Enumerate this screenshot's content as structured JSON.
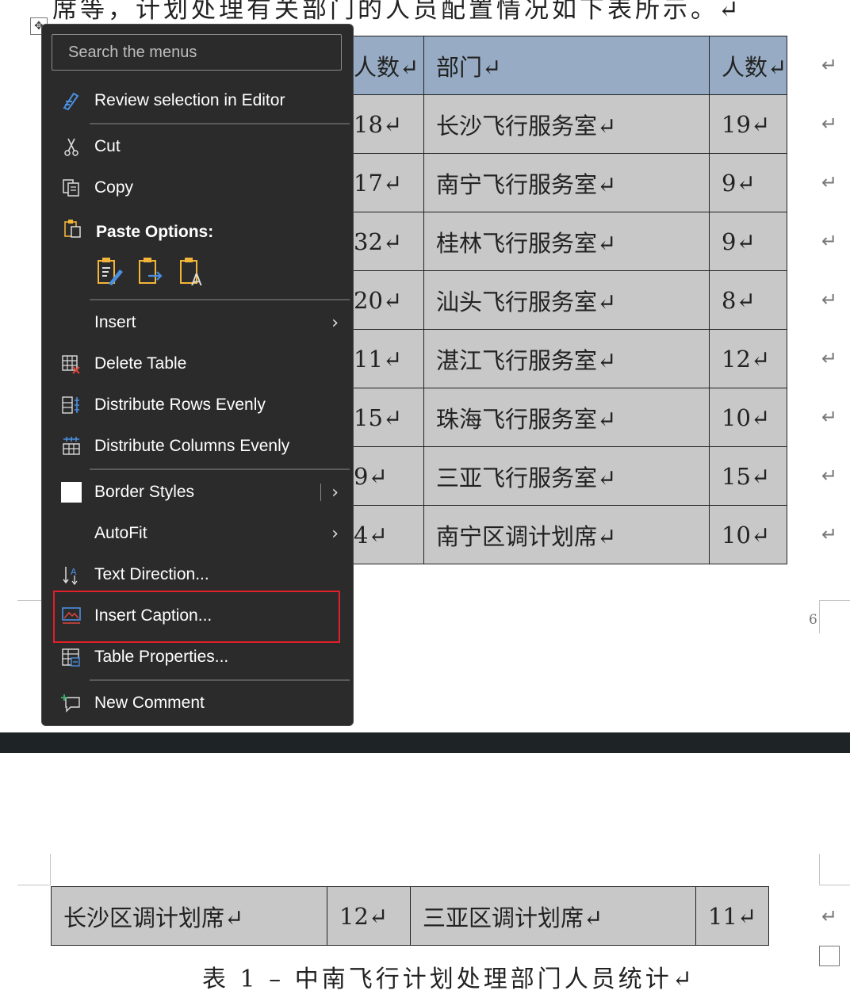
{
  "document": {
    "intro_text": "席等，计划处理有关部门的人员配置情况如下表所示。↵",
    "page_number": "6",
    "top_table": {
      "header": [
        "人数↵",
        "部门↵",
        "人数↵"
      ],
      "rows": [
        [
          "18↵",
          "长沙飞行服务室↵",
          "19↵"
        ],
        [
          "17↵",
          "南宁飞行服务室↵",
          "9↵"
        ],
        [
          "32↵",
          "桂林飞行服务室↵",
          "9↵"
        ],
        [
          "20↵",
          "汕头飞行服务室↵",
          "8↵"
        ],
        [
          "11↵",
          "湛江飞行服务室↵",
          "12↵"
        ],
        [
          "15↵",
          "珠海飞行服务室↵",
          "10↵"
        ],
        [
          "9↵",
          "三亚飞行服务室↵",
          "15↵"
        ],
        [
          "4↵",
          "南宁区调计划席↵",
          "10↵"
        ]
      ]
    },
    "bottom_table": {
      "rows": [
        [
          "长沙区调计划席↵",
          "12↵",
          "三亚区调计划席↵",
          "11↵"
        ]
      ]
    },
    "row_end_mark": "↵",
    "caption": "表 1 – 中南飞行计划处理部门人员统计↵"
  },
  "context_menu": {
    "search_placeholder": "Search the menus",
    "review_selection": "Review selection in Editor",
    "cut": "Cut",
    "copy": "Copy",
    "paste_options": "Paste Options:",
    "insert": "Insert",
    "delete_table": "Delete Table",
    "distribute_rows": "Distribute Rows Evenly",
    "distribute_columns": "Distribute Columns Evenly",
    "border_styles": "Border Styles",
    "autofit": "AutoFit",
    "text_direction": "Text Direction...",
    "insert_caption": "Insert Caption...",
    "table_properties": "Table Properties...",
    "new_comment": "New Comment",
    "highlight_color": "#e0202a",
    "accent_color": "#4a8fe0"
  }
}
